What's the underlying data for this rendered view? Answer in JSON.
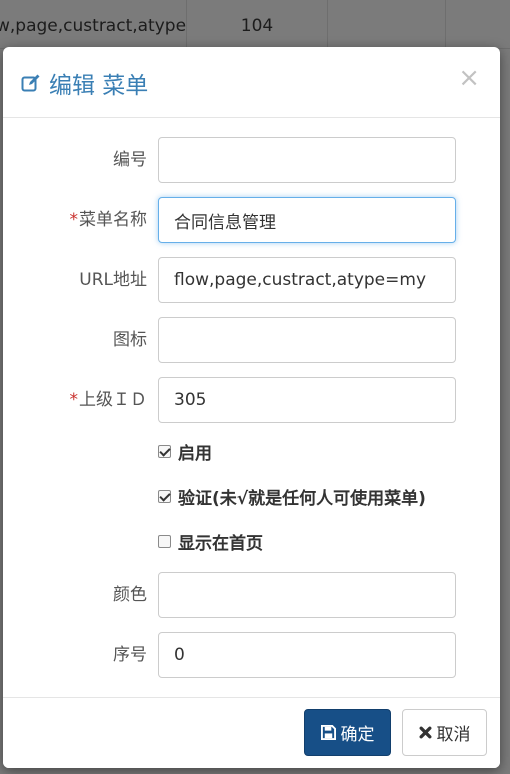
{
  "background": {
    "first_row": {
      "url": "w,page,custract,atype",
      "num": "104"
    }
  },
  "modal": {
    "title": "编辑 菜单",
    "close": "×",
    "fields": {
      "id": {
        "label": "编号",
        "value": "",
        "required": false
      },
      "name": {
        "label": "菜单名称",
        "value": "合同信息管理",
        "required": true
      },
      "url": {
        "label": "URL地址",
        "value": "flow,page,custract,atype=my",
        "required": false
      },
      "icon": {
        "label": "图标",
        "value": "",
        "required": false
      },
      "parent_id": {
        "label": "上级ＩＤ",
        "value": "305",
        "required": true
      },
      "color": {
        "label": "颜色",
        "value": "",
        "required": false
      },
      "order": {
        "label": "序号",
        "value": "0",
        "required": false
      }
    },
    "required_mark": "*",
    "checkboxes": {
      "enabled": {
        "label": "启用",
        "checked": true
      },
      "verify": {
        "label": "验证(未√就是任何人可使用菜单)",
        "checked": true
      },
      "show_home": {
        "label": "显示在首页",
        "checked": false
      }
    },
    "buttons": {
      "ok": "确定",
      "cancel": "取消"
    }
  },
  "colors": {
    "title": "#3a7fb4",
    "primary_button": "#174f87",
    "required": "#c9302c",
    "focus_border": "#66afe9"
  }
}
